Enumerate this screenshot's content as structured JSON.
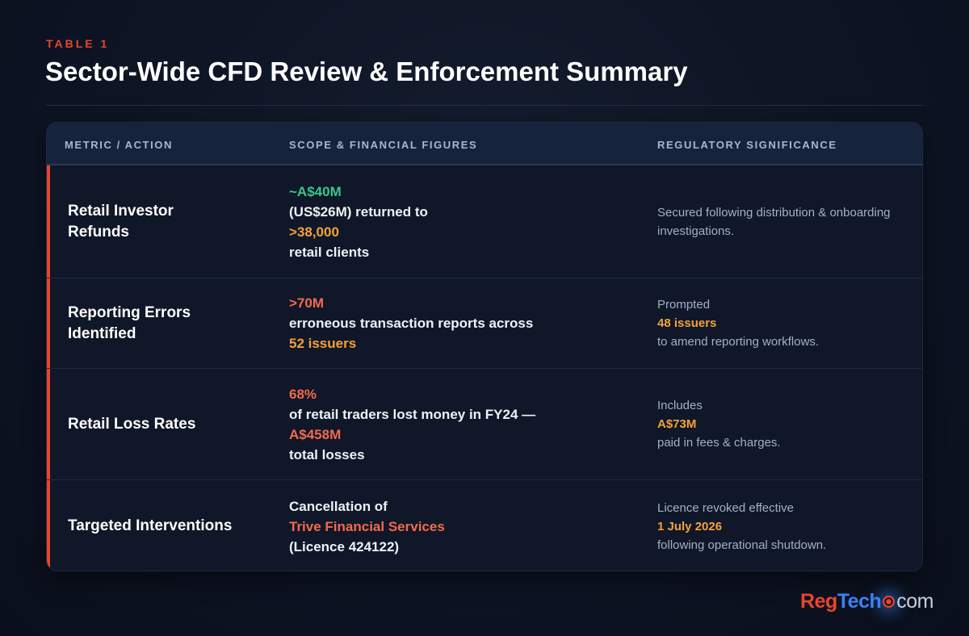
{
  "header": {
    "eyebrow": "TABLE 1",
    "title": "Sector-Wide CFD Review & Enforcement Summary"
  },
  "table": {
    "columns": [
      "METRIC / ACTION",
      "SCOPE & FINANCIAL FIGURES",
      "REGULATORY SIGNIFICANCE"
    ],
    "rows": [
      {
        "metric": "Retail Investor Refunds",
        "scope": [
          "~A$40M",
          "(US$26M) returned to",
          ">38,000",
          "retail clients"
        ],
        "significance": [
          "Secured following distribution & onboarding investigations."
        ]
      },
      {
        "metric": "Reporting Errors Identified",
        "scope": [
          ">70M",
          "erroneous transaction reports across",
          "52 issuers"
        ],
        "significance": [
          "Prompted",
          "48 issuers",
          "to amend reporting workflows."
        ]
      },
      {
        "metric": "Retail Loss Rates",
        "scope": [
          "68%",
          "of retail traders lost money in FY24 —",
          "A$458M",
          "total losses"
        ],
        "significance": [
          "Includes",
          "A$73M",
          "paid in fees & charges."
        ]
      },
      {
        "metric": "Targeted Interventions",
        "scope": [
          "Cancellation of",
          "Trive Financial Services",
          "(Licence 424122)"
        ],
        "significance": [
          "Licence revoked effective",
          "1 July 2026",
          "following operational shutdown."
        ]
      }
    ]
  },
  "brand": {
    "reg": "Reg",
    "tech": "Tech",
    "dotcom": "com"
  },
  "colors": {
    "accent_red": "#e8452f",
    "highlight_green": "#36c88a",
    "highlight_orange": "#f5a13a",
    "highlight_red": "#f4694b",
    "brand_blue": "#3b82f6"
  }
}
